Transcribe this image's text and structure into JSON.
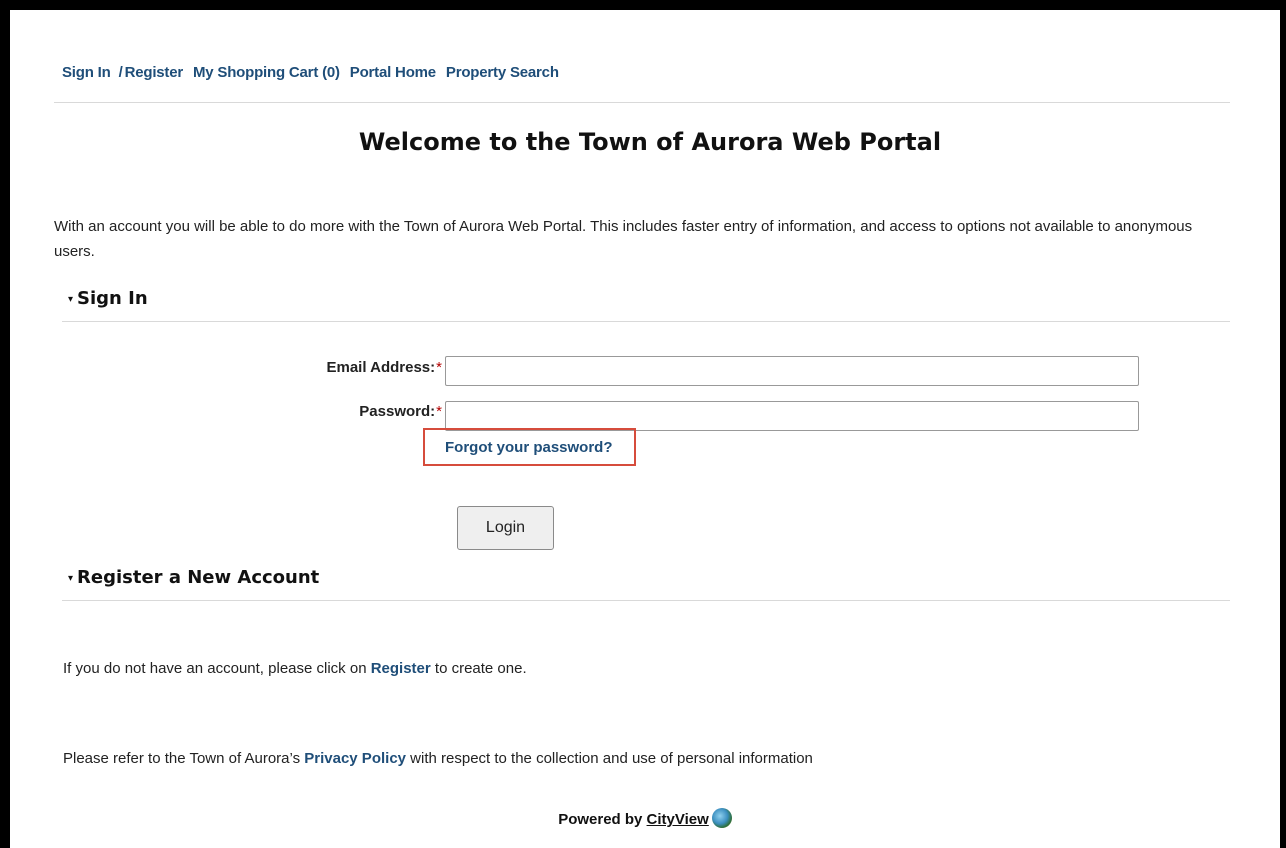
{
  "nav": {
    "sign_in": "Sign In",
    "separator": "/",
    "register": "Register",
    "cart": "My Shopping Cart (0)",
    "portal_home": "Portal Home",
    "property_search": "Property Search"
  },
  "page_title": "Welcome to the Town of Aurora Web Portal",
  "intro_text": "With an account you will be able to do more with the Town of Aurora Web Portal. This includes faster entry of information, and access to options not available to anonymous users.",
  "sign_in_section": {
    "heading": "Sign In",
    "caret": "▾",
    "email_label": "Email Address:",
    "email_value": "",
    "password_label": "Password:",
    "password_value": "",
    "required_mark": "*",
    "forgot_link": "Forgot your password?",
    "login_button": "Login"
  },
  "register_section": {
    "heading": "Register a New Account",
    "caret": "▾",
    "text_before": "If you do not have an account, please click on ",
    "link": "Register",
    "text_after": " to create one."
  },
  "privacy": {
    "text_before": "Please refer to the Town of Aurora’s ",
    "link": "Privacy Policy",
    "text_after": " with respect to the collection and use of personal information"
  },
  "footer": {
    "powered_by": "Powered by ",
    "brand": "CityView",
    "logo_icon": "cityview-globe-icon"
  },
  "colors": {
    "link": "#1f4e79",
    "required": "#b30000",
    "highlight_box": "#d64c3c"
  }
}
